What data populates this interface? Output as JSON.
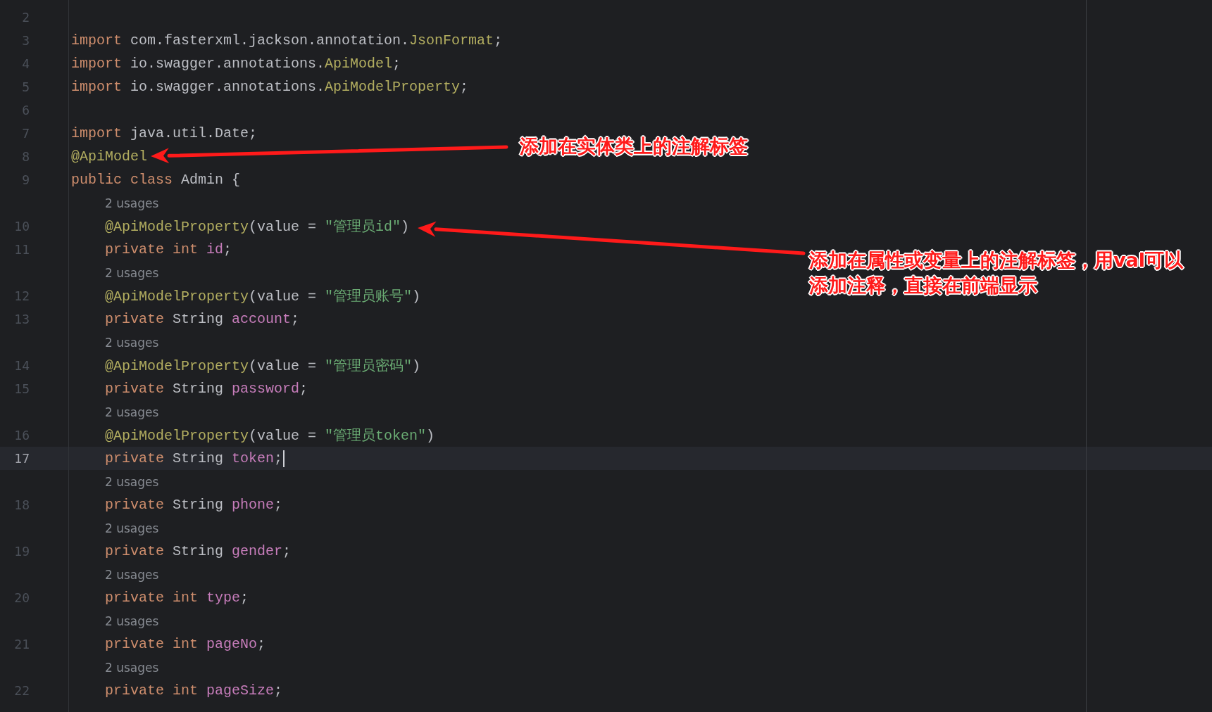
{
  "editor": {
    "lines": [
      {
        "kind": "blank",
        "number": "2"
      },
      {
        "kind": "code",
        "number": "3",
        "tokens": [
          {
            "kind": "keyword",
            "text": "import"
          },
          {
            "kind": "plain",
            "text": " com.fasterxml.jackson.annotation."
          },
          {
            "kind": "class",
            "text": "JsonFormat"
          },
          {
            "kind": "plain",
            "text": ";"
          }
        ]
      },
      {
        "kind": "code",
        "number": "4",
        "tokens": [
          {
            "kind": "keyword",
            "text": "import"
          },
          {
            "kind": "plain",
            "text": " io.swagger.annotations."
          },
          {
            "kind": "class",
            "text": "ApiModel"
          },
          {
            "kind": "plain",
            "text": ";"
          }
        ]
      },
      {
        "kind": "code",
        "number": "5",
        "tokens": [
          {
            "kind": "keyword",
            "text": "import"
          },
          {
            "kind": "plain",
            "text": " io.swagger.annotations."
          },
          {
            "kind": "class",
            "text": "ApiModelProperty"
          },
          {
            "kind": "plain",
            "text": ";"
          }
        ]
      },
      {
        "kind": "blank",
        "number": "6"
      },
      {
        "kind": "code",
        "number": "7",
        "tokens": [
          {
            "kind": "keyword",
            "text": "import"
          },
          {
            "kind": "plain",
            "text": " java.util.Date;"
          }
        ]
      },
      {
        "kind": "code",
        "number": "8",
        "tokens": [
          {
            "kind": "class",
            "text": "@ApiModel"
          }
        ]
      },
      {
        "kind": "code",
        "number": "9",
        "tokens": [
          {
            "kind": "keyword",
            "text": "public class"
          },
          {
            "kind": "plain",
            "text": " Admin {"
          }
        ],
        "children": [
          {
            "kind": "hint",
            "text": "2 usages"
          },
          {
            "kind": "code",
            "number": "10",
            "tokens": [
              {
                "kind": "class",
                "text": "@ApiModelProperty"
              },
              {
                "kind": "plain",
                "text": "(value = "
              },
              {
                "kind": "string",
                "text": "\"管理员id\""
              },
              {
                "kind": "plain",
                "text": ")"
              }
            ]
          },
          {
            "kind": "code",
            "number": "11",
            "tokens": [
              {
                "kind": "keyword",
                "text": "private int"
              },
              {
                "kind": "field",
                "text": " id"
              },
              {
                "kind": "plain",
                "text": ";"
              }
            ]
          },
          {
            "kind": "hint",
            "text": "2 usages"
          },
          {
            "kind": "code",
            "number": "12",
            "tokens": [
              {
                "kind": "class",
                "text": "@ApiModelProperty"
              },
              {
                "kind": "plain",
                "text": "(value = "
              },
              {
                "kind": "string",
                "text": "\"管理员账号\""
              },
              {
                "kind": "plain",
                "text": ")"
              }
            ]
          },
          {
            "kind": "code",
            "number": "13",
            "tokens": [
              {
                "kind": "keyword",
                "text": "private"
              },
              {
                "kind": "plain",
                "text": " String"
              },
              {
                "kind": "field",
                "text": " account"
              },
              {
                "kind": "plain",
                "text": ";"
              }
            ]
          },
          {
            "kind": "hint",
            "text": "2 usages"
          },
          {
            "kind": "code",
            "number": "14",
            "tokens": [
              {
                "kind": "class",
                "text": "@ApiModelProperty"
              },
              {
                "kind": "plain",
                "text": "(value = "
              },
              {
                "kind": "string",
                "text": "\"管理员密码\""
              },
              {
                "kind": "plain",
                "text": ")"
              }
            ]
          },
          {
            "kind": "code",
            "number": "15",
            "tokens": [
              {
                "kind": "keyword",
                "text": "private"
              },
              {
                "kind": "plain",
                "text": " String"
              },
              {
                "kind": "field",
                "text": " password"
              },
              {
                "kind": "plain",
                "text": ";"
              }
            ]
          },
          {
            "kind": "hint",
            "text": "2 usages"
          },
          {
            "kind": "code",
            "number": "16",
            "tokens": [
              {
                "kind": "class",
                "text": "@ApiModelProperty"
              },
              {
                "kind": "plain",
                "text": "(value = "
              },
              {
                "kind": "string",
                "text": "\"管理员token\""
              },
              {
                "kind": "plain",
                "text": ")"
              }
            ]
          },
          {
            "kind": "code",
            "number": "17",
            "current": true,
            "tokens": [
              {
                "kind": "keyword",
                "text": "private"
              },
              {
                "kind": "plain",
                "text": " String"
              },
              {
                "kind": "field",
                "text": " token"
              },
              {
                "kind": "plain",
                "text": ";"
              }
            ]
          },
          {
            "kind": "hint",
            "text": "2 usages"
          },
          {
            "kind": "code",
            "number": "18",
            "tokens": [
              {
                "kind": "keyword",
                "text": "private"
              },
              {
                "kind": "plain",
                "text": " String"
              },
              {
                "kind": "field",
                "text": " phone"
              },
              {
                "kind": "plain",
                "text": ";"
              }
            ]
          },
          {
            "kind": "hint",
            "text": "2 usages"
          },
          {
            "kind": "code",
            "number": "19",
            "tokens": [
              {
                "kind": "keyword",
                "text": "private"
              },
              {
                "kind": "plain",
                "text": " String"
              },
              {
                "kind": "field",
                "text": " gender"
              },
              {
                "kind": "plain",
                "text": ";"
              }
            ]
          },
          {
            "kind": "hint",
            "text": "2 usages"
          },
          {
            "kind": "code",
            "number": "20",
            "tokens": [
              {
                "kind": "keyword",
                "text": "private int"
              },
              {
                "kind": "field",
                "text": " type"
              },
              {
                "kind": "plain",
                "text": ";"
              }
            ]
          },
          {
            "kind": "hint",
            "text": "2 usages"
          },
          {
            "kind": "code",
            "number": "21",
            "tokens": [
              {
                "kind": "keyword",
                "text": "private int"
              },
              {
                "kind": "field",
                "text": " pageNo"
              },
              {
                "kind": "plain",
                "text": ";"
              }
            ]
          },
          {
            "kind": "hint",
            "text": "2 usages"
          },
          {
            "kind": "code",
            "number": "22",
            "tokens": [
              {
                "kind": "keyword",
                "text": "private int"
              },
              {
                "kind": "field",
                "text": " pageSize"
              },
              {
                "kind": "plain",
                "text": ";"
              }
            ]
          }
        ]
      }
    ]
  },
  "callouts": [
    {
      "lines": [
        "添加在实体类上的注解标签"
      ]
    },
    {
      "lines": [
        "添加在属性或变量上的注解标签，用val可以",
        "添加注释，直接在前端显示"
      ]
    }
  ]
}
